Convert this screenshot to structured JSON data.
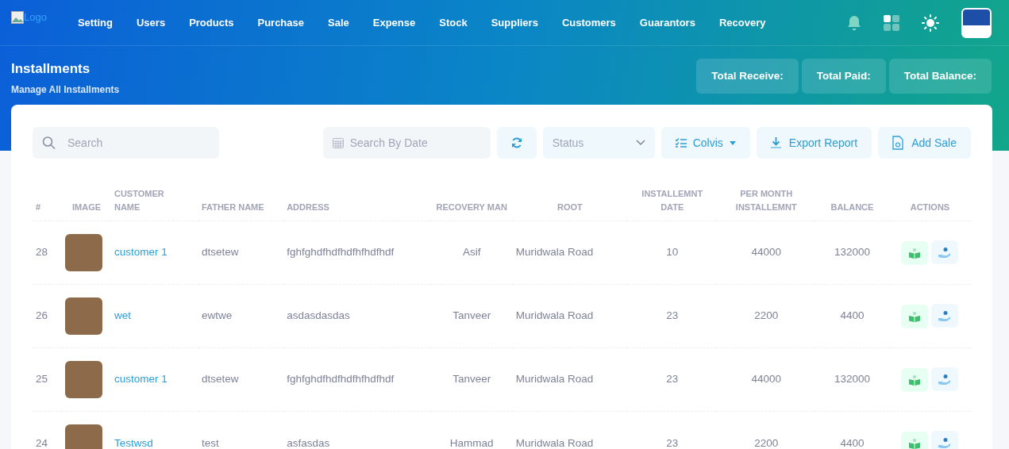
{
  "nav": {
    "logo_alt": "Logo",
    "items": [
      "Setting",
      "Users",
      "Products",
      "Purchase",
      "Sale",
      "Expense",
      "Stock",
      "Suppliers",
      "Customers",
      "Guarantors",
      "Recovery"
    ]
  },
  "header": {
    "title": "Installments",
    "subtitle": "Manage All Installments",
    "totals": [
      "Total Receive:",
      "Total Paid:",
      "Total Balance:"
    ]
  },
  "toolbar": {
    "search": {
      "placeholder": "Search"
    },
    "date": {
      "placeholder": "Search By Date"
    },
    "status": {
      "value": "Status"
    },
    "buttons": [
      {
        "label": "Colvis",
        "kind": "dropdown"
      },
      {
        "label": "Export Report",
        "kind": "export"
      },
      {
        "label": "Add Sale",
        "kind": "add"
      }
    ]
  },
  "table": {
    "columns": [
      "#",
      "IMAGE",
      "CUSTOMER NAME",
      "FATHER NAME",
      "ADDRESS",
      "RECOVERY MAN",
      "ROOT",
      "INSTALLEMNT DATE",
      "PER MONTH INSTALLEMNT",
      "BALANCE",
      "ACTIONS"
    ],
    "rows": [
      {
        "number": "28",
        "customer_name": "customer 1",
        "father_name": "dtsetew",
        "address": "fghfghdfhdfhdfhfhdfhdf",
        "recovery_man": "Asif",
        "root": "Muridwala Road",
        "installment_date": "10",
        "per_month": "44000",
        "balance": "132000"
      },
      {
        "number": "26",
        "customer_name": "wet",
        "father_name": "ewtwe",
        "address": "asdasdasdas",
        "recovery_man": "Tanveer",
        "root": "Muridwala Road",
        "installment_date": "23",
        "per_month": "2200",
        "balance": "4400"
      },
      {
        "number": "25",
        "customer_name": "customer 1",
        "father_name": "dtsetew",
        "address": "fghfghdfhdfhdfhfhdfhdf",
        "recovery_man": "Tanveer",
        "root": "Muridwala Road",
        "installment_date": "23",
        "per_month": "44000",
        "balance": "132000"
      },
      {
        "number": "24",
        "customer_name": "Testwsd",
        "father_name": "test",
        "address": "asfasdas",
        "recovery_man": "Hammad",
        "root": "Muridwala Road",
        "installment_date": "23",
        "per_month": "2200",
        "balance": "4400"
      }
    ]
  }
}
